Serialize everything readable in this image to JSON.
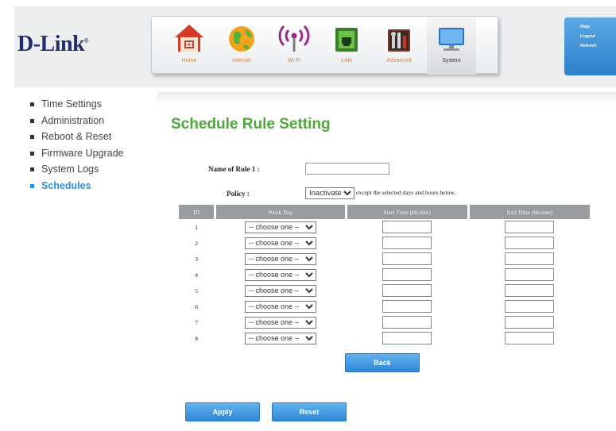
{
  "brand": {
    "logo_text": "D-Link",
    "logo_mark": "®"
  },
  "nav": {
    "items": [
      {
        "label": "Home",
        "icon": "home-icon"
      },
      {
        "label": "Internet",
        "icon": "globe-icon"
      },
      {
        "label": "Wi-Fi",
        "icon": "wifi-icon"
      },
      {
        "label": "LAN",
        "icon": "lan-icon"
      },
      {
        "label": "Advanced",
        "icon": "tools-icon"
      },
      {
        "label": "System",
        "icon": "monitor-icon"
      }
    ],
    "active": "System"
  },
  "help_links": {
    "help": "Help",
    "logout": "Logout",
    "refresh": "Refresh"
  },
  "sidebar": {
    "items": [
      {
        "label": "Time Settings"
      },
      {
        "label": "Administration"
      },
      {
        "label": "Reboot & Reset"
      },
      {
        "label": "Firmware Upgrade"
      },
      {
        "label": "System Logs"
      },
      {
        "label": "Schedules"
      }
    ],
    "active": "Schedules"
  },
  "page": {
    "title": "Schedule Rule Setting"
  },
  "form": {
    "name_label": "Name of Rule 1 :",
    "name_value": "",
    "policy_label": "Policy :",
    "policy_value": "Inactivate",
    "policy_note": "except the selected days and hours below."
  },
  "table": {
    "headers": {
      "id": "ID",
      "week_day": "Week Day",
      "start_time": "Start Time (hh:mm)",
      "end_time": "End Time (hh:mm)"
    },
    "rows": [
      {
        "id": "1",
        "week_day": "-- choose one --",
        "start": "",
        "end": ""
      },
      {
        "id": "2",
        "week_day": "-- choose one --",
        "start": "",
        "end": ""
      },
      {
        "id": "3",
        "week_day": "-- choose one --",
        "start": "",
        "end": ""
      },
      {
        "id": "4",
        "week_day": "-- choose one --",
        "start": "",
        "end": ""
      },
      {
        "id": "5",
        "week_day": "-- choose one --",
        "start": "",
        "end": ""
      },
      {
        "id": "6",
        "week_day": "-- choose one --",
        "start": "",
        "end": ""
      },
      {
        "id": "7",
        "week_day": "-- choose one --",
        "start": "",
        "end": ""
      },
      {
        "id": "8",
        "week_day": "-- choose one --",
        "start": "",
        "end": ""
      }
    ]
  },
  "buttons": {
    "back": "Back",
    "apply": "Apply",
    "reset": "Reset"
  },
  "colors": {
    "accent": "#2a8fe0",
    "title_green": "#4fa63a",
    "brand_navy": "#1f2f6b",
    "nav_label": "#d8843a"
  }
}
